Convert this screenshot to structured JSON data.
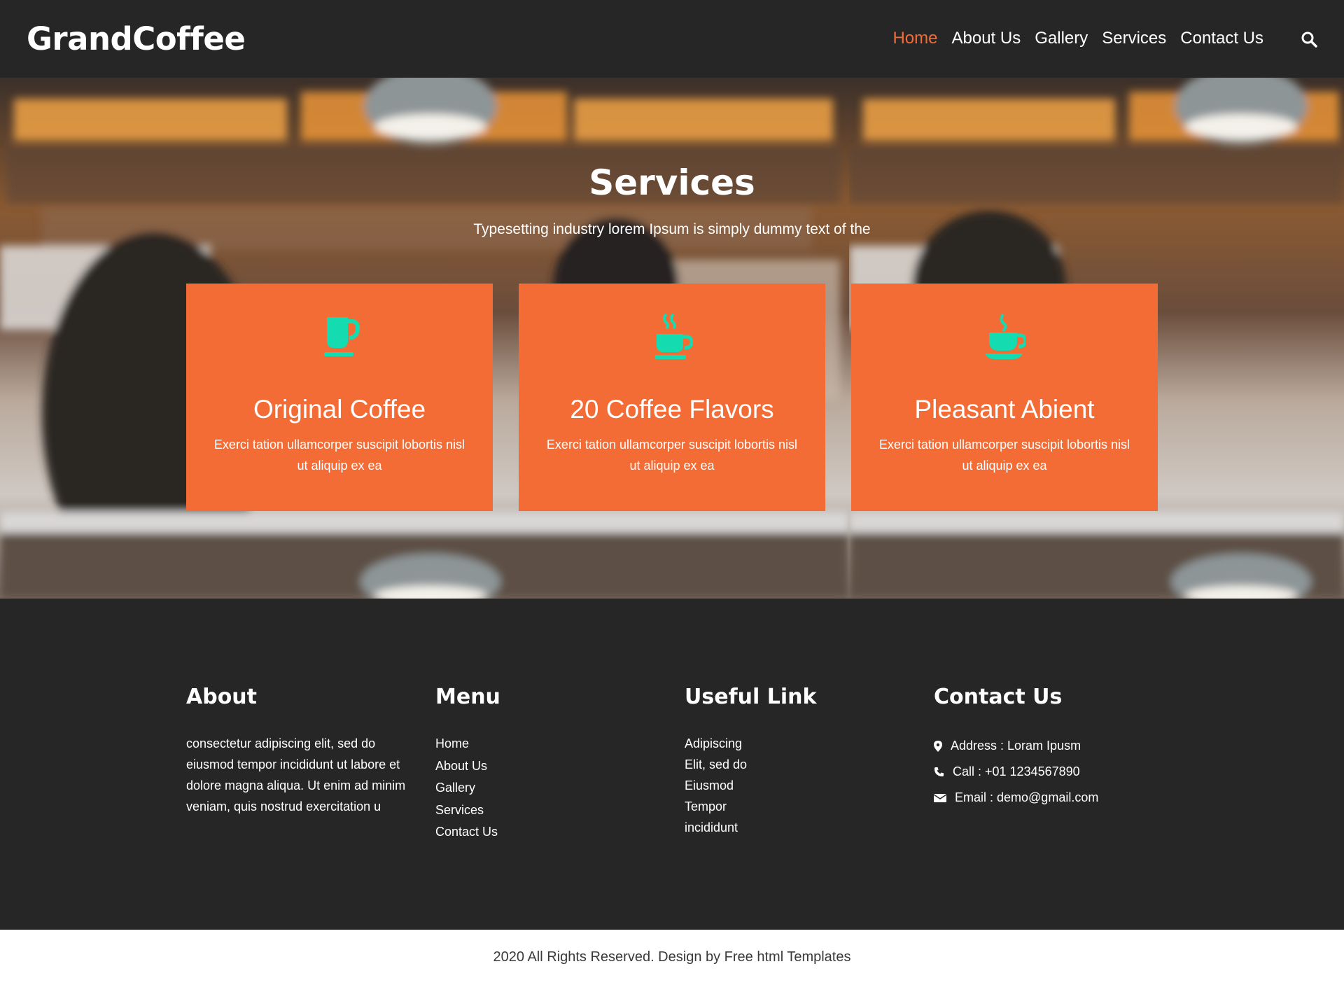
{
  "header": {
    "brand": "GrandCoffee",
    "nav": [
      "Home",
      "About Us",
      "Gallery",
      "Services",
      "Contact Us"
    ],
    "active_nav": "Home"
  },
  "hero": {
    "title": "Services",
    "subtitle": "Typesetting industry lorem Ipsum is simply dummy text of the"
  },
  "cards": [
    {
      "title": "Original Coffee",
      "text": "Exerci tation ullamcorper suscipit lobortis nisl ut aliquip ex ea",
      "icon": "coffee-mug-icon"
    },
    {
      "title": "20 Coffee Flavors",
      "text": "Exerci tation ullamcorper suscipit lobortis nisl ut aliquip ex ea",
      "icon": "steaming-cup-icon"
    },
    {
      "title": "Pleasant Abient",
      "text": "Exerci tation ullamcorper suscipit lobortis nisl ut aliquip ex ea",
      "icon": "coffee-cup-icon"
    }
  ],
  "footer": {
    "about": {
      "title": "About",
      "text": "consectetur adipiscing elit, sed do eiusmod tempor incididunt ut labore et dolore magna aliqua. Ut enim ad minim veniam, quis nostrud exercitation u"
    },
    "menu": {
      "title": "Menu",
      "links": [
        "Home",
        "About Us",
        "Gallery",
        "Services",
        "Contact Us"
      ]
    },
    "useful": {
      "title": "Useful Link",
      "links": [
        "Adipiscing",
        "Elit, sed do",
        "Eiusmod",
        "Tempor",
        "incididunt"
      ]
    },
    "contact": {
      "title": "Contact Us",
      "address": "Address : Loram Ipusm",
      "call": "Call : +01 1234567890",
      "email": "Email : demo@gmail.com"
    }
  },
  "copyright": "2020 All Rights Reserved. Design by Free html Templates",
  "colors": {
    "accent": "#f36c36",
    "icon": "#14dbb0",
    "dark": "#262626"
  }
}
